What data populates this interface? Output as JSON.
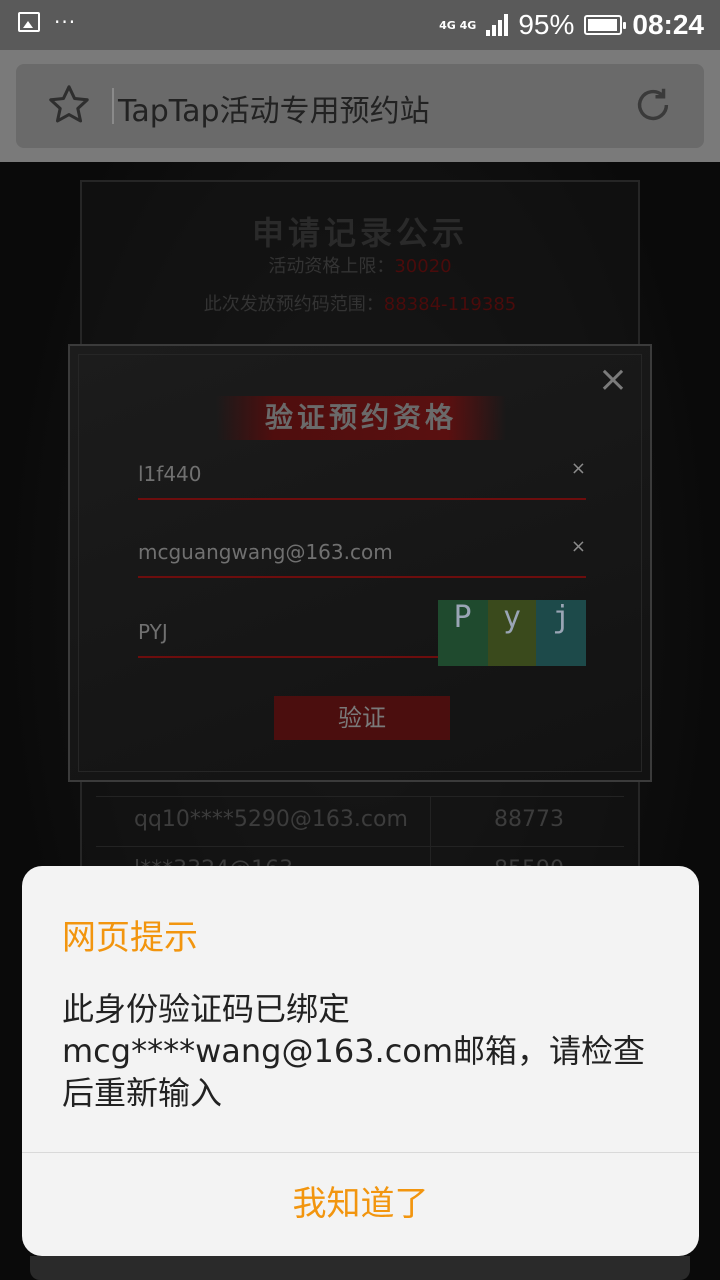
{
  "statusbar": {
    "dots": "···",
    "network": "4G 4G",
    "battery_percent": "95%",
    "battery_level": 0.95,
    "time": "08:24",
    "icons": [
      "image-icon",
      "more-dots-icon",
      "signal-icon",
      "battery-icon"
    ]
  },
  "browser": {
    "title": "TapTap活动专用预约站",
    "icons": [
      "star-icon",
      "refresh-icon"
    ]
  },
  "record": {
    "title": "申请记录公示",
    "limit_label": "活动资格上限：",
    "limit_value": "30020",
    "range_label": "此次发放预约码范围：",
    "range_value": "88384-119385",
    "rows": [
      {
        "email": "qq10****5290@163.com",
        "code": "88773"
      },
      {
        "email": "l***3324@163",
        "code": "85590"
      }
    ]
  },
  "verify": {
    "title": "验证预约资格",
    "close": "×",
    "code_value": "l1f440",
    "email_value": "mcguangwang@163.com",
    "captcha_input": "PYJ",
    "captcha_chars": [
      "P",
      "y",
      "j"
    ],
    "clear": "×",
    "button": "验证"
  },
  "alert": {
    "title": "网页提示",
    "message": "此身份验证码已绑定mcg****wang@163.com邮箱，请检查后重新输入",
    "ok": "我知道了",
    "accent": "#f2950e"
  }
}
